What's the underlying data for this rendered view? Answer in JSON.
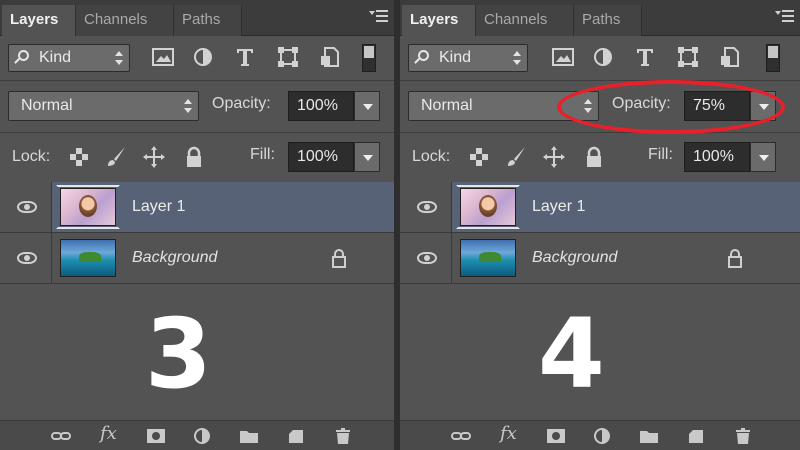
{
  "tabs": [
    "Layers",
    "Channels",
    "Paths"
  ],
  "kind_label": "Kind",
  "blend_mode": "Normal",
  "opacity_label": "Opacity:",
  "lock_label": "Lock:",
  "fill_label": "Fill:",
  "layers": [
    {
      "name": "Layer 1",
      "selected": true
    },
    {
      "name": "Background",
      "locked": true
    }
  ],
  "panels": [
    {
      "step": "3",
      "opacity": "100%",
      "fill": "100%"
    },
    {
      "step": "4",
      "opacity": "75%",
      "fill": "100%"
    }
  ],
  "colors": {
    "selection": "#576276",
    "highlight_ring": "#e8202a",
    "panel": "#535353"
  },
  "footer_icons": [
    "link-icon",
    "fx-icon",
    "mask-icon",
    "adjustment-icon",
    "folder-icon",
    "new-layer-icon",
    "trash-icon"
  ]
}
